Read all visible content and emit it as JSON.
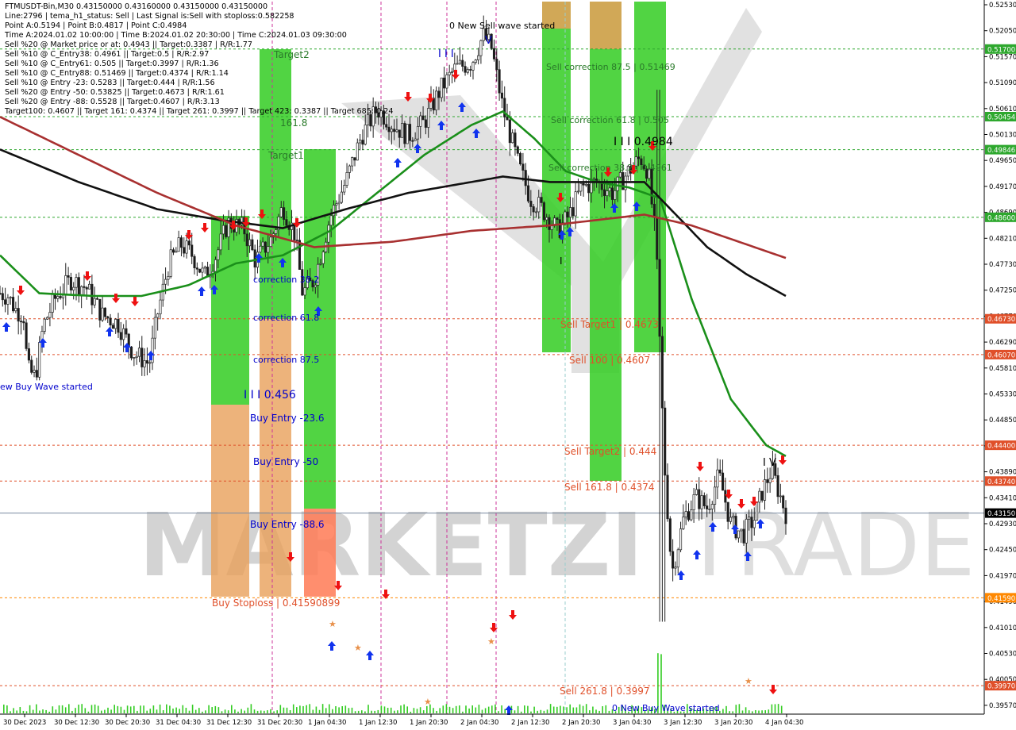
{
  "info": {
    "lines": [
      "FTMUSDT-Bin,M30  0.43150000 0.43160000 0.43150000 0.43150000",
      "Line:2796 | tema_h1_status: Sell | Last Signal is:Sell with stoploss:0.582258",
      "Point A:0.5194 | Point B:0.4817 | Point C:0.4984",
      "Time A:2024.01.02 10:00:00 | Time B:2024.01.02 20:30:00 | Time C:2024.01.03 09:30:00",
      "Sell %20 @ Market price or at: 0.4943 || Target:0.3387 | R/R:1.77",
      "Sell %10 @ C_Entry38: 0.4961 || Target:0.5 | R/R:2.97",
      "Sell %10 @ C_Entry61: 0.505 || Target:0.3997 | R/R:1.36",
      "Sell %10 @ C_Entry88: 0.51469 || Target:0.4374 | R/R:1.14",
      "Sell %10 @ Entry -23: 0.5283 || Target:0.444 | R/R:1.56",
      "Sell %20 @ Entry -50: 0.53825 || Target:0.4673 | R/R:1.61",
      "Sell %20 @ Entry -88: 0.5528 || Target:0.4607 | R/R:3.13",
      "Target100: 0.4607 || Target 161: 0.4374 || Target 261: 0.3997 || Target 423: 0.3387 || Target 685: 0.24"
    ]
  },
  "watermark": {
    "text1": "MARKETZI",
    "text2": "TRADE"
  },
  "price_axis": {
    "ticks": [
      "0.52530",
      "0.52050",
      "0.51570",
      "0.51090",
      "0.50610",
      "0.50130",
      "0.49650",
      "0.49170",
      "0.48690",
      "0.48210",
      "0.47730",
      "0.47250",
      "0.46770",
      "0.46290",
      "0.45810",
      "0.45330",
      "0.44850",
      "0.44370",
      "0.43890",
      "0.43410",
      "0.42930",
      "0.42450",
      "0.41970",
      "0.41490",
      "0.41010",
      "0.40530",
      "0.40050",
      "0.39570"
    ],
    "tags": [
      {
        "text": "0.51700",
        "color": "#2ea82e"
      },
      {
        "text": "0.50454",
        "color": "#2ea82e"
      },
      {
        "text": "0.49846",
        "color": "#2ea82e"
      },
      {
        "text": "0.48600",
        "color": "#2ea82e"
      },
      {
        "text": "0.46730",
        "color": "#e0502a"
      },
      {
        "text": "0.46070",
        "color": "#e0502a"
      },
      {
        "text": "0.44400",
        "color": "#e0502a"
      },
      {
        "text": "0.43740",
        "color": "#e0502a"
      },
      {
        "text": "0.43150",
        "color": "#000000"
      },
      {
        "text": "0.41590",
        "color": "#ff8800"
      },
      {
        "text": "0.39970",
        "color": "#e0502a"
      }
    ]
  },
  "time_axis": {
    "labels": [
      "30 Dec 2023",
      "30 Dec 12:30",
      "30 Dec 20:30",
      "31 Dec 04:30",
      "31 Dec 12:30",
      "31 Dec 20:30",
      "1 Jan 04:30",
      "1 Jan 12:30",
      "1 Jan 20:30",
      "2 Jan 04:30",
      "2 Jan 12:30",
      "2 Jan 20:30",
      "3 Jan 04:30",
      "3 Jan 12:30",
      "3 Jan 20:30",
      "4 Jan 04:30"
    ]
  },
  "annotations": {
    "new_sell_wave": "0 New Sell wave started",
    "new_buy_wave_left": "ew Buy Wave started",
    "new_buy_wave_bottom": "0 New Buy Wave started",
    "target2": "Target2",
    "target1": "Target1",
    "t161": "161.8",
    "correction382": "correction 38.2",
    "correction618": "correction 61.8",
    "correction875": "correction 87.5",
    "level_0456": "I I I 0.456",
    "buy_entry_236": "Buy Entry -23.6",
    "buy_entry_50": "Buy Entry -50",
    "buy_entry_886": "Buy Entry -88.6",
    "buy_stoploss": "Buy Stoploss | 0.41590899",
    "sell_corr_875": "Sell correction 87.5 | 0.51469",
    "sell_corr_618": "Sell correction 61.8 | 0.505",
    "sell_corr_382": "Sell correction 38.2 | 0.4961",
    "level_0984": "I I I 0.4984",
    "sell_target1": "Sell Target1 | 0.4673",
    "sell_100": "Sell 100 | 0.4607",
    "sell_target2": "Sell Target2 | 0.444",
    "sell_1618": "Sell 161.8 | 0.4374",
    "sell_2618": "Sell 261.8 | 0.3997",
    "wave_I": "I",
    "wave_IV": "I V",
    "wave_V": "V",
    "wave_top_I": "I I I"
  },
  "chart_data": {
    "type": "candlestick",
    "symbol": "FTMUSDT-Bin",
    "timeframe": "M30",
    "ylim": [
      0.3949,
      0.5253
    ],
    "x_categories": [
      "30 Dec 2023",
      "30 Dec 12:30",
      "30 Dec 20:30",
      "31 Dec 04:30",
      "31 Dec 12:30",
      "31 Dec 20:30",
      "1 Jan 04:30",
      "1 Jan 12:30",
      "1 Jan 20:30",
      "2 Jan 04:30",
      "2 Jan 12:30",
      "2 Jan 20:30",
      "3 Jan 04:30",
      "3 Jan 12:30",
      "3 Jan 20:30",
      "4 Jan 04:30"
    ],
    "horizontal_levels": [
      {
        "value": 0.517,
        "style": "dashed",
        "color": "#2ea82e"
      },
      {
        "value": 0.50454,
        "style": "dashed",
        "color": "#2ea82e"
      },
      {
        "value": 0.49846,
        "style": "dashed",
        "color": "#2ea82e"
      },
      {
        "value": 0.486,
        "style": "dashed",
        "color": "#2ea82e"
      },
      {
        "value": 0.4673,
        "style": "dashed",
        "color": "#e0502a"
      },
      {
        "value": 0.4607,
        "style": "dashed",
        "color": "#e0502a"
      },
      {
        "value": 0.444,
        "style": "dashed",
        "color": "#e0502a"
      },
      {
        "value": 0.4374,
        "style": "dashed",
        "color": "#e0502a"
      },
      {
        "value": 0.4315,
        "style": "solid",
        "color": "#7a8aa0"
      },
      {
        "value": 0.4159,
        "style": "dashed",
        "color": "#ff8800"
      },
      {
        "value": 0.3997,
        "style": "dashed",
        "color": "#e0502a"
      }
    ],
    "price_keypoints": [
      [
        0,
        0.472
      ],
      [
        0.01,
        0.4715
      ],
      [
        0.02,
        0.469
      ],
      [
        0.03,
        0.468
      ],
      [
        0.035,
        0.458
      ],
      [
        0.045,
        0.4565
      ],
      [
        0.055,
        0.466
      ],
      [
        0.07,
        0.471
      ],
      [
        0.09,
        0.4745
      ],
      [
        0.11,
        0.473
      ],
      [
        0.13,
        0.468
      ],
      [
        0.15,
        0.4665
      ],
      [
        0.17,
        0.461
      ],
      [
        0.19,
        0.459
      ],
      [
        0.2,
        0.468
      ],
      [
        0.215,
        0.4775
      ],
      [
        0.23,
        0.481
      ],
      [
        0.245,
        0.479
      ],
      [
        0.26,
        0.475
      ],
      [
        0.275,
        0.479
      ],
      [
        0.29,
        0.485
      ],
      [
        0.31,
        0.484
      ],
      [
        0.325,
        0.478
      ],
      [
        0.345,
        0.482
      ],
      [
        0.36,
        0.488
      ],
      [
        0.375,
        0.483
      ],
      [
        0.385,
        0.472
      ],
      [
        0.4,
        0.4745
      ],
      [
        0.42,
        0.486
      ],
      [
        0.44,
        0.4925
      ],
      [
        0.46,
        0.501
      ],
      [
        0.48,
        0.506
      ],
      [
        0.5,
        0.503
      ],
      [
        0.52,
        0.501
      ],
      [
        0.54,
        0.5035
      ],
      [
        0.56,
        0.5095
      ],
      [
        0.58,
        0.5135
      ],
      [
        0.6,
        0.5145
      ],
      [
        0.615,
        0.5195
      ],
      [
        0.625,
        0.5175
      ],
      [
        0.64,
        0.506
      ],
      [
        0.66,
        0.4955
      ],
      [
        0.675,
        0.4895
      ],
      [
        0.69,
        0.4875
      ],
      [
        0.71,
        0.4835
      ],
      [
        0.725,
        0.4865
      ],
      [
        0.74,
        0.4915
      ],
      [
        0.76,
        0.4925
      ],
      [
        0.78,
        0.4905
      ],
      [
        0.8,
        0.4945
      ],
      [
        0.815,
        0.497
      ],
      [
        0.825,
        0.4945
      ],
      [
        0.835,
        0.481
      ],
      [
        0.845,
        0.4415
      ],
      [
        0.855,
        0.4205
      ],
      [
        0.87,
        0.4305
      ],
      [
        0.885,
        0.4345
      ],
      [
        0.9,
        0.4325
      ],
      [
        0.915,
        0.4385
      ],
      [
        0.93,
        0.4295
      ],
      [
        0.945,
        0.4275
      ],
      [
        0.96,
        0.4305
      ],
      [
        0.97,
        0.4355
      ],
      [
        0.982,
        0.4395
      ],
      [
        1,
        0.4315
      ]
    ],
    "series": [
      {
        "color": "#1a8f1a",
        "keypoints": [
          [
            0.0,
            0.479
          ],
          [
            0.05,
            0.472
          ],
          [
            0.12,
            0.4715
          ],
          [
            0.18,
            0.4715
          ],
          [
            0.24,
            0.4735
          ],
          [
            0.3,
            0.4775
          ],
          [
            0.36,
            0.479
          ],
          [
            0.42,
            0.4835
          ],
          [
            0.48,
            0.4905
          ],
          [
            0.54,
            0.4975
          ],
          [
            0.6,
            0.503
          ],
          [
            0.64,
            0.5055
          ],
          [
            0.68,
            0.5005
          ],
          [
            0.72,
            0.4945
          ],
          [
            0.76,
            0.4925
          ],
          [
            0.8,
            0.4915
          ],
          [
            0.84,
            0.4895
          ],
          [
            0.88,
            0.471
          ],
          [
            0.93,
            0.4525
          ],
          [
            0.975,
            0.444
          ],
          [
            1.0,
            0.442
          ]
        ]
      },
      {
        "color": "#111111",
        "keypoints": [
          [
            0.0,
            0.4985
          ],
          [
            0.1,
            0.4925
          ],
          [
            0.2,
            0.4875
          ],
          [
            0.28,
            0.4855
          ],
          [
            0.36,
            0.484
          ],
          [
            0.44,
            0.4875
          ],
          [
            0.52,
            0.4905
          ],
          [
            0.6,
            0.4925
          ],
          [
            0.64,
            0.4935
          ],
          [
            0.7,
            0.4925
          ],
          [
            0.76,
            0.4925
          ],
          [
            0.82,
            0.4925
          ],
          [
            0.86,
            0.4865
          ],
          [
            0.9,
            0.4805
          ],
          [
            0.95,
            0.4755
          ],
          [
            1.0,
            0.4715
          ]
        ]
      },
      {
        "color": "#a83030",
        "keypoints": [
          [
            0.0,
            0.5045
          ],
          [
            0.1,
            0.4975
          ],
          [
            0.2,
            0.4905
          ],
          [
            0.3,
            0.4845
          ],
          [
            0.4,
            0.4805
          ],
          [
            0.5,
            0.4815
          ],
          [
            0.6,
            0.4835
          ],
          [
            0.7,
            0.4845
          ],
          [
            0.76,
            0.4855
          ],
          [
            0.82,
            0.4865
          ],
          [
            0.88,
            0.4845
          ],
          [
            0.94,
            0.4815
          ],
          [
            1.0,
            0.4785
          ]
        ]
      }
    ],
    "colored_zones": [
      {
        "label": "Target2",
        "color": "#33cc22",
        "y_top": 0.5165,
        "y_bottom": 0.4205
      },
      {
        "label": "Target1",
        "color": "#33cc22",
        "y_top": 0.4985,
        "y_bottom": 0.4205
      },
      {
        "label": "Buy Entry -23.6",
        "color": "#e8a05a",
        "y_top": 0.4505,
        "y_bottom": 0.4165
      },
      {
        "label": "Sell correction 87.5 | 0.51469",
        "color": "#e8a05a",
        "y_top": 0.5253,
        "y_bottom": 0.5155
      },
      {
        "label": "Sell 100 | 0.4607",
        "color": "#33cc22",
        "y_top": 0.5253,
        "y_bottom": 0.4205
      }
    ]
  }
}
